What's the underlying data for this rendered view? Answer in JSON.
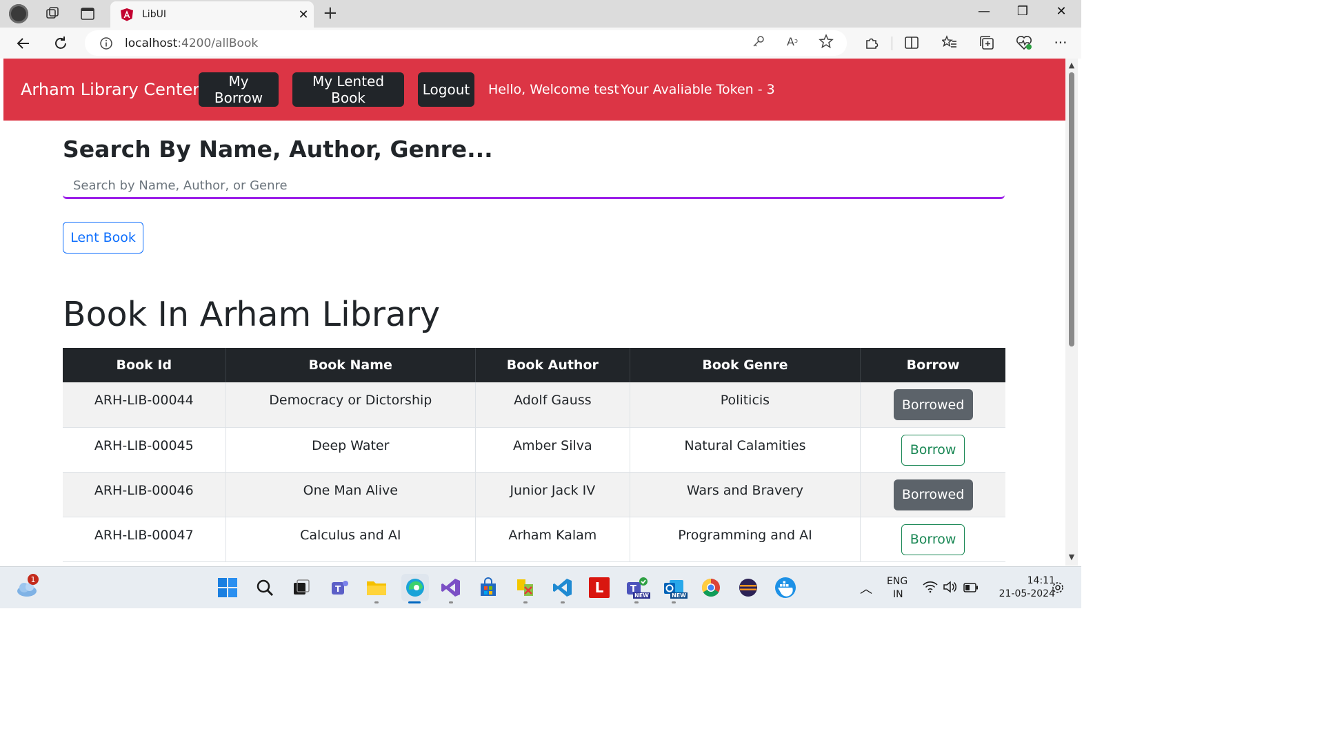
{
  "browser": {
    "tab_title": "LibUI",
    "url_host": "localhost",
    "url_path": ":4200/allBook"
  },
  "navbar": {
    "brand": "Arham Library Center",
    "my_borrow": "My Borrow",
    "my_lented": "My Lented Book",
    "logout": "Logout",
    "welcome": "Hello, Welcome test",
    "tokens": "Your Avaliable Token - 3",
    "bg_color": "#dc3545"
  },
  "search": {
    "title": "Search By Name, Author, Genre...",
    "placeholder": "Search by Name, Author, or Genre",
    "value": ""
  },
  "lent_button": "Lent Book",
  "section_title": "Book In Arham Library",
  "table": {
    "headers": [
      "Book Id",
      "Book Name",
      "Book Author",
      "Book Genre",
      "Borrow"
    ],
    "rows": [
      {
        "id": "ARH-LIB-00044",
        "name": "Democracy or Dictorship",
        "author": "Adolf Gauss",
        "genre": "Politicis",
        "action": "Borrowed"
      },
      {
        "id": "ARH-LIB-00045",
        "name": "Deep Water",
        "author": "Amber Silva",
        "genre": "Natural Calamities",
        "action": "Borrow"
      },
      {
        "id": "ARH-LIB-00046",
        "name": "One Man Alive",
        "author": "Junior Jack IV",
        "genre": "Wars and Bravery",
        "action": "Borrowed"
      },
      {
        "id": "ARH-LIB-00047",
        "name": "Calculus and AI",
        "author": "Arham Kalam",
        "genre": "Programming and AI",
        "action": "Borrow"
      }
    ]
  },
  "taskbar": {
    "weather_badge": "1",
    "lang_top": "ENG",
    "lang_bottom": "IN",
    "time": "14:11",
    "date": "21-05-2024",
    "app_letter": "L",
    "new_badge_1": "NEW",
    "new_badge_2": "NEW"
  }
}
